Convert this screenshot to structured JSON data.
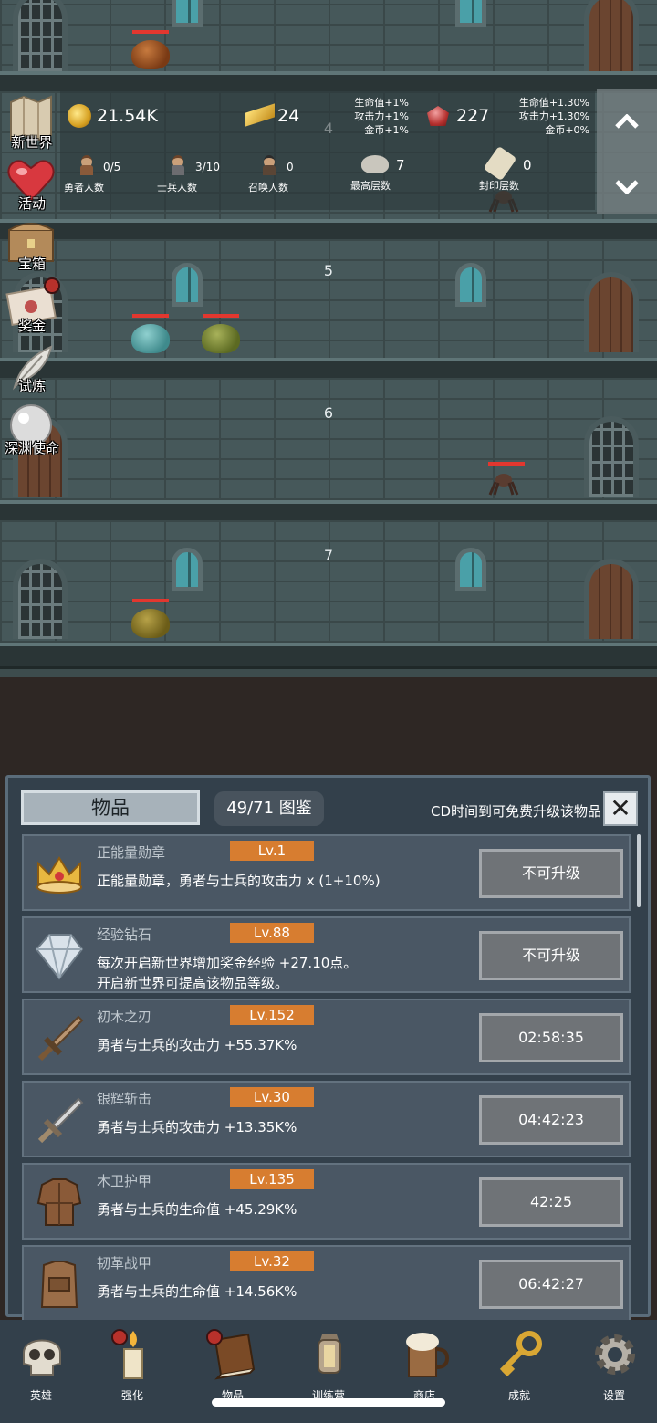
{
  "floors": [
    "4",
    "5",
    "6",
    "7"
  ],
  "hud": {
    "gold": "21.54K",
    "gold_bars": "24",
    "gold_bonus_lines": [
      "生命值+1%",
      "攻击力+1%",
      "金币+1%"
    ],
    "gems": "227",
    "gem_bonus_lines": [
      "生命值+1.30%",
      "攻击力+1.30%",
      "金币+0%"
    ],
    "stats": [
      {
        "icon": "hero-icon",
        "count": "0/5",
        "label": "勇者人数"
      },
      {
        "icon": "soldier-icon",
        "count": "3/10",
        "label": "士兵人数"
      },
      {
        "icon": "summon-icon",
        "count": "0",
        "label": "召唤人数"
      },
      {
        "icon": "rock-icon",
        "count": "7",
        "label": "最高层数"
      },
      {
        "icon": "seal-scroll-icon",
        "count": "0",
        "label": "封印层数"
      }
    ],
    "scroll_up": "⌃",
    "scroll_down": "⌄"
  },
  "side_menu": [
    {
      "label": "新世界",
      "icon": "map-icon"
    },
    {
      "label": "活动",
      "icon": "heart-icon"
    },
    {
      "label": "宝箱",
      "icon": "chest-icon"
    },
    {
      "label": "奖金",
      "icon": "envelope-icon"
    },
    {
      "label": "试炼",
      "icon": "feather-icon"
    },
    {
      "label": "深渊使命",
      "icon": "pearl-icon"
    }
  ],
  "panel": {
    "tab_label": "物品",
    "collection": "49/71 图鉴",
    "cd_hint": "CD时间到可免费升级该物品",
    "close": "✕",
    "items": [
      {
        "name": "正能量勋章",
        "level": "Lv.1",
        "desc": "正能量勋章，勇者与士兵的攻击力 x (1+10%)",
        "button": "不可升级",
        "icon": "crown-icon"
      },
      {
        "name": "经验钻石",
        "level": "Lv.88",
        "desc": "每次开启新世界增加奖金经验 +27.10点。\n开启新世界可提高该物品等级。",
        "button": "不可升级",
        "icon": "diamond-icon"
      },
      {
        "name": "初木之刃",
        "level": "Lv.152",
        "desc": "勇者与士兵的攻击力 +55.37K%",
        "button": "02:58:35",
        "icon": "wooden-sword-icon"
      },
      {
        "name": "银辉斩击",
        "level": "Lv.30",
        "desc": "勇者与士兵的攻击力 +13.35K%",
        "button": "04:42:23",
        "icon": "silver-sword-icon"
      },
      {
        "name": "木卫护甲",
        "level": "Lv.135",
        "desc": "勇者与士兵的生命值 +45.29K%",
        "button": "42:25",
        "icon": "wood-armor-icon"
      },
      {
        "name": "韧革战甲",
        "level": "Lv.32",
        "desc": "勇者与士兵的生命值 +14.56K%",
        "button": "06:42:27",
        "icon": "leather-armor-icon"
      }
    ]
  },
  "nav": [
    {
      "label": "英雄",
      "icon": "skull-icon",
      "dot": false
    },
    {
      "label": "强化",
      "icon": "candle-icon",
      "dot": true
    },
    {
      "label": "物品",
      "icon": "book-icon",
      "dot": true
    },
    {
      "label": "训练营",
      "icon": "lantern-icon",
      "dot": false
    },
    {
      "label": "商店",
      "icon": "beer-mug-icon",
      "dot": false
    },
    {
      "label": "成就",
      "icon": "key-icon",
      "dot": false
    },
    {
      "label": "设置",
      "icon": "gear-icon",
      "dot": false
    }
  ],
  "colors": {
    "level_badge": "#d77d30",
    "panel_bg": "#33404b",
    "hp_bar": "#e2372f"
  }
}
